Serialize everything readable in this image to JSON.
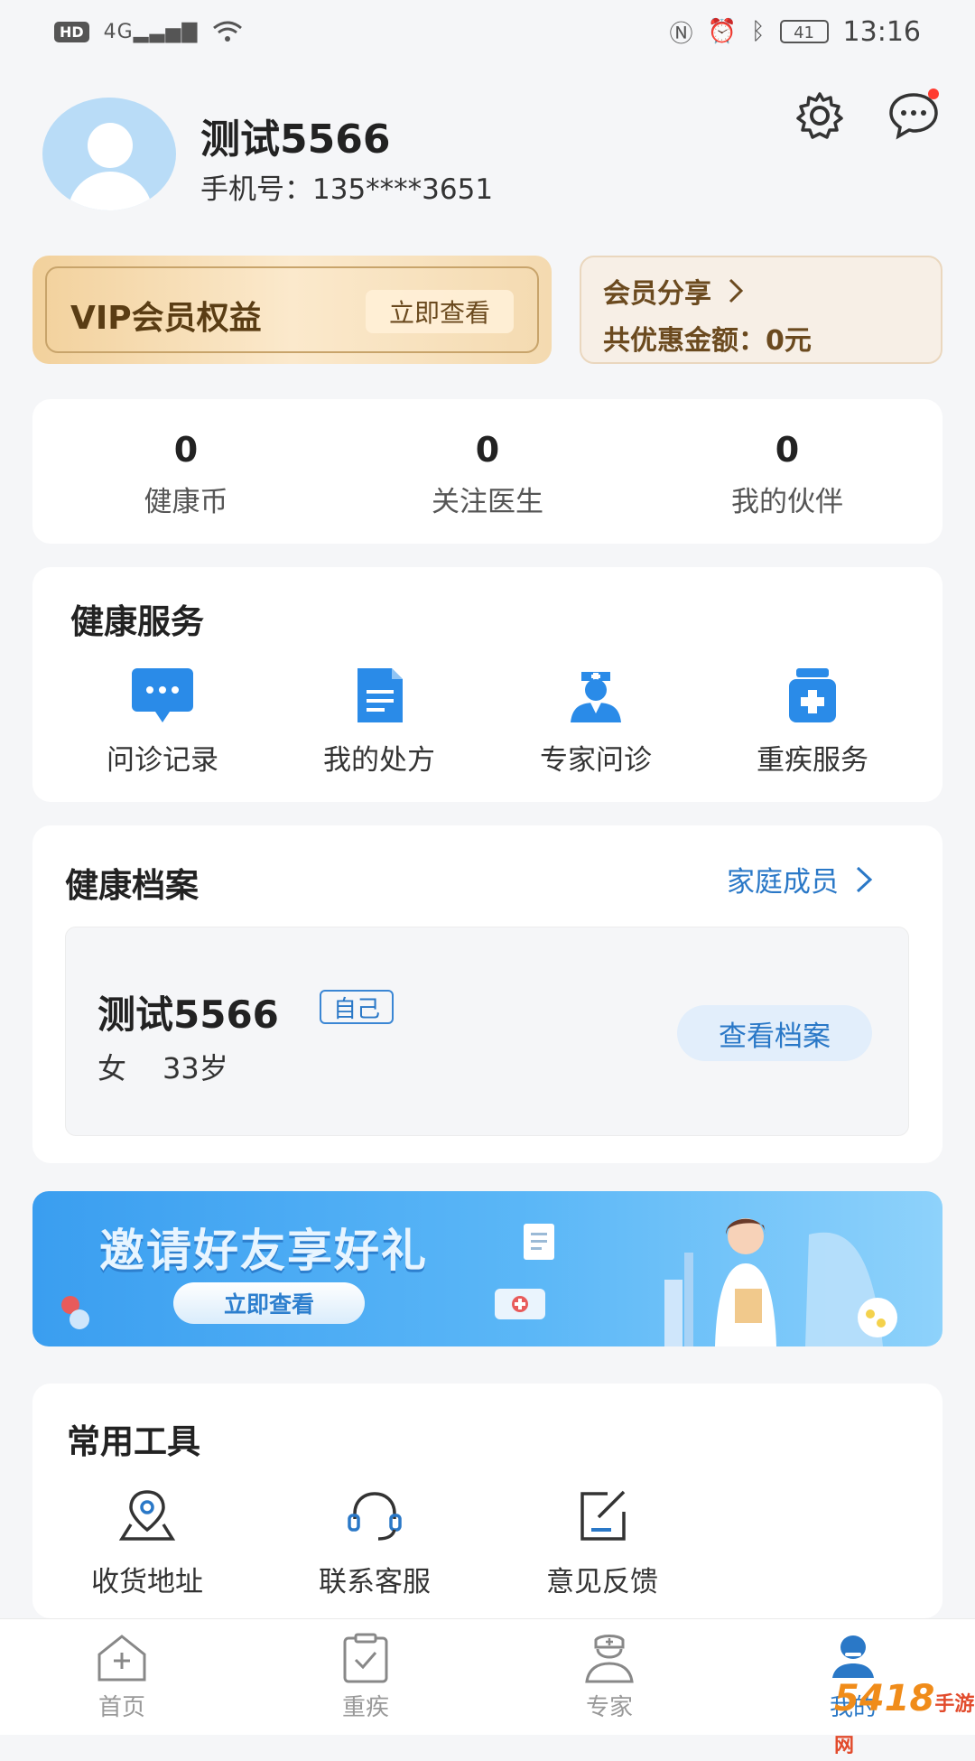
{
  "status_bar": {
    "hd": "HD",
    "network": "4G",
    "time": "13:16",
    "battery": "41"
  },
  "profile": {
    "name": "测试5566",
    "phone": "手机号：135****3651"
  },
  "vip": {
    "title": "VIP会员权益",
    "button": "立即查看"
  },
  "share": {
    "title": "会员分享",
    "amount": "共优惠金额：0元"
  },
  "stats": [
    {
      "value": "0",
      "label": "健康币"
    },
    {
      "value": "0",
      "label": "关注医生"
    },
    {
      "value": "0",
      "label": "我的伙伴"
    }
  ],
  "health_services": {
    "title": "健康服务",
    "items": [
      {
        "label": "问诊记录",
        "icon": "chat-bubble-icon"
      },
      {
        "label": "我的处方",
        "icon": "document-icon"
      },
      {
        "label": "专家问诊",
        "icon": "doctor-icon"
      },
      {
        "label": "重疾服务",
        "icon": "medicine-bottle-icon"
      }
    ]
  },
  "health_records": {
    "title": "健康档案",
    "family_link": "家庭成员",
    "name": "测试5566",
    "tag": "自己",
    "gender": "女",
    "age": "33岁",
    "button": "查看档案"
  },
  "banner": {
    "title": "邀请好友享好礼",
    "button": "立即查看"
  },
  "tools": {
    "title": "常用工具",
    "items": [
      {
        "label": "收货地址",
        "icon": "location-pin-icon"
      },
      {
        "label": "联系客服",
        "icon": "headset-icon"
      },
      {
        "label": "意见反馈",
        "icon": "feedback-edit-icon"
      }
    ]
  },
  "tabbar": {
    "active_index": 3,
    "items": [
      {
        "label": "首页",
        "icon": "home-icon"
      },
      {
        "label": "重疾",
        "icon": "clipboard-check-icon"
      },
      {
        "label": "专家",
        "icon": "doctor-icon"
      },
      {
        "label": "我的",
        "icon": "profile-icon"
      }
    ]
  },
  "watermark": {
    "text": "5418",
    "sub": "手游网"
  },
  "colors": {
    "accent": "#2a78c7",
    "vip_gold": "#f2d19c",
    "banner_blue": "#3a9ef0",
    "background": "#f5f6f8"
  }
}
